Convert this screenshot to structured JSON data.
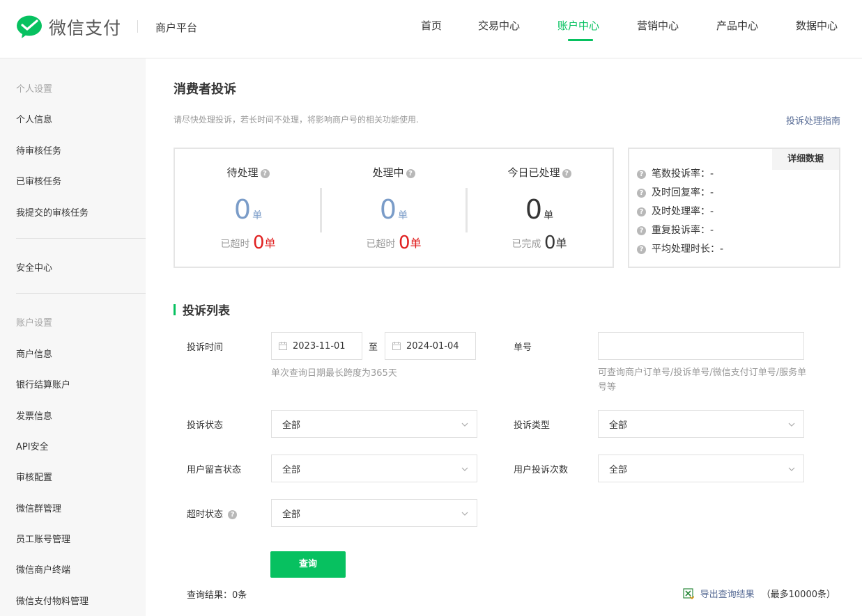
{
  "header": {
    "brand": "微信支付",
    "platform": "商户平台",
    "nav": [
      {
        "label": "首页",
        "active": false
      },
      {
        "label": "交易中心",
        "active": false
      },
      {
        "label": "账户中心",
        "active": true
      },
      {
        "label": "营销中心",
        "active": false
      },
      {
        "label": "产品中心",
        "active": false
      },
      {
        "label": "数据中心",
        "active": false
      }
    ]
  },
  "sidebar": {
    "group1": "个人设置",
    "items1": [
      "个人信息",
      "待审核任务",
      "已审核任务",
      "我提交的审核任务"
    ],
    "security": "安全中心",
    "group2": "账户设置",
    "items2": [
      "商户信息",
      "银行结算账户",
      "发票信息",
      "API安全",
      "审核配置",
      "微信群管理",
      "员工账号管理",
      "微信商户终端",
      "微信支付物料管理"
    ]
  },
  "page": {
    "title": "消费者投诉",
    "notice": "请尽快处理投诉，若长时间不处理，将影响商户号的相关功能使用.",
    "guide_link": "投诉处理指南"
  },
  "stats": {
    "pending": {
      "label": "待处理",
      "value": "0",
      "unit": "单",
      "sub_label": "已超时",
      "sub_value": "0",
      "sub_unit": "单"
    },
    "processing": {
      "label": "处理中",
      "value": "0",
      "unit": "单",
      "sub_label": "已超时",
      "sub_value": "0",
      "sub_unit": "单"
    },
    "today": {
      "label": "今日已处理",
      "value": "0",
      "unit": "单",
      "sub_label": "已完成",
      "sub_value": "0",
      "sub_unit": "单"
    }
  },
  "detail": {
    "button": "详细数据",
    "metrics": [
      {
        "label": "笔数投诉率：",
        "value": "-"
      },
      {
        "label": "及时回复率：",
        "value": "-"
      },
      {
        "label": "及时处理率：",
        "value": "-"
      },
      {
        "label": "重复投诉率：",
        "value": "-"
      },
      {
        "label": "平均处理时长：",
        "value": "-"
      }
    ]
  },
  "list": {
    "title": "投诉列表",
    "time_label": "投诉时间",
    "date_from": "2023-11-01",
    "date_sep": "至",
    "date_to": "2024-01-04",
    "date_hint": "单次查询日期最长跨度为365天",
    "number_label": "单号",
    "number_value": "",
    "number_hint": "可查询商户订单号/投诉单号/微信支付订单号/服务单号等",
    "status_label": "投诉状态",
    "status_value": "全部",
    "type_label": "投诉类型",
    "type_value": "全部",
    "msg_label": "用户留言状态",
    "msg_value": "全部",
    "count_label": "用户投诉次数",
    "count_value": "全部",
    "timeout_label": "超时状态",
    "timeout_value": "全部",
    "query_button": "查询",
    "result_count": "查询结果：0条",
    "export_link": "导出查询结果",
    "export_note": "（最多10000条）"
  },
  "colors": {
    "brand": "#07c160",
    "link": "#576b95",
    "alert": "#e02020",
    "stat_blue": "#7a9cc8"
  }
}
